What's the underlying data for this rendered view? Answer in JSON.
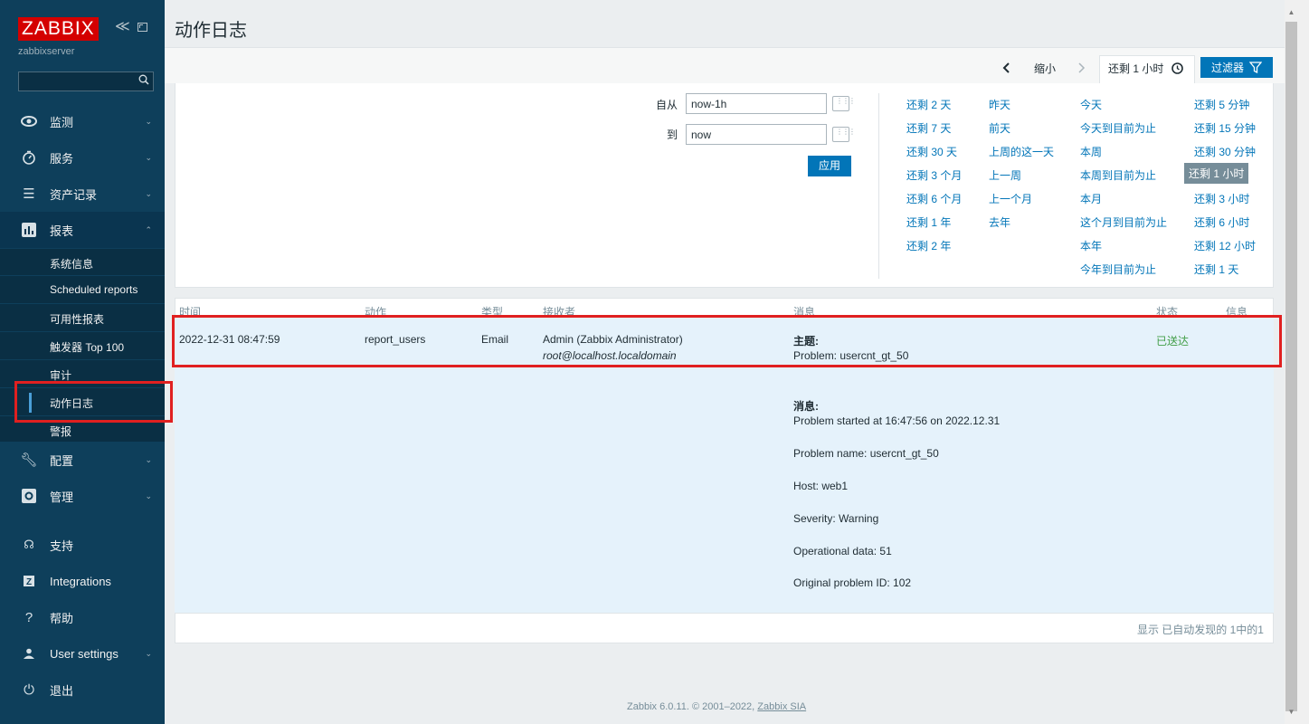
{
  "sidebar": {
    "logo": "ZABBIX",
    "server_name": "zabbixserver",
    "collapse": "≪",
    "menu": [
      {
        "label": "监测",
        "icon": "eye-icon"
      },
      {
        "label": "服务",
        "icon": "clock-icon"
      },
      {
        "label": "资产记录",
        "icon": "list-icon"
      },
      {
        "label": "报表",
        "icon": "chart-icon"
      },
      {
        "label": "配置",
        "icon": "wrench-icon"
      },
      {
        "label": "管理",
        "icon": "gear-icon"
      },
      {
        "label": "支持",
        "icon": "headset-icon"
      },
      {
        "label": "Integrations",
        "icon": "z-icon"
      },
      {
        "label": "帮助",
        "icon": "question-icon"
      },
      {
        "label": "User settings",
        "icon": "user-icon"
      },
      {
        "label": "退出",
        "icon": "power-icon"
      }
    ],
    "submenu": [
      "系统信息",
      "Scheduled reports",
      "可用性报表",
      "触发器 Top 100",
      "审计",
      "动作日志",
      "警报"
    ]
  },
  "page": {
    "title": "动作日志"
  },
  "timebar": {
    "zoom_out": "缩小",
    "current_range": "还剩 1 小时",
    "filter": "过滤器"
  },
  "filter": {
    "from_label": "自从",
    "from_value": "now-1h",
    "to_label": "到",
    "to_value": "now",
    "apply": "应用",
    "quick": {
      "col1": [
        "还剩 2 天",
        "还剩 7 天",
        "还剩 30 天",
        "还剩 3 个月",
        "还剩 6 个月",
        "还剩 1 年",
        "还剩 2 年"
      ],
      "col2": [
        "昨天",
        "前天",
        "上周的这一天",
        "上一周",
        "上一个月",
        "去年"
      ],
      "col3": [
        "今天",
        "今天到目前为止",
        "本周",
        "本周到目前为止",
        "本月",
        "这个月到目前为止",
        "本年",
        "今年到目前为止"
      ],
      "col4": [
        "还剩 5 分钟",
        "还剩 15 分钟",
        "还剩 30 分钟",
        "还剩 1 小时",
        "还剩 3 小时",
        "还剩 6 小时",
        "还剩 12 小时",
        "还剩 1 天"
      ]
    }
  },
  "table": {
    "headers": [
      "时间",
      "动作",
      "类型",
      "接收者",
      "消息",
      "状态",
      "信息"
    ],
    "row": {
      "time": "2022-12-31 08:47:59",
      "action": "report_users",
      "type": "Email",
      "recipient_name": "Admin (Zabbix Administrator)",
      "recipient_addr": "root@localhost.localdomain",
      "subject_label": "主题:",
      "subject": "Problem: usercnt_gt_50",
      "message_label": "消息:",
      "message_lines": [
        "Problem started at 16:47:56 on 2022.12.31",
        "Problem name: usercnt_gt_50",
        "Host: web1",
        "Severity: Warning",
        "Operational data: 51",
        "Original problem ID: 102"
      ],
      "status": "已送达"
    },
    "paging": "显示 已自动发现的 1中的1"
  },
  "footer": {
    "copyright": "Zabbix 6.0.11. © 2001–2022,",
    "company": "Zabbix SIA"
  },
  "colors": {
    "sidebar": "#0e3f5b",
    "accent": "#0275b8",
    "logo": "#d40000",
    "highlight": "#e02020",
    "ok": "#429e47"
  }
}
